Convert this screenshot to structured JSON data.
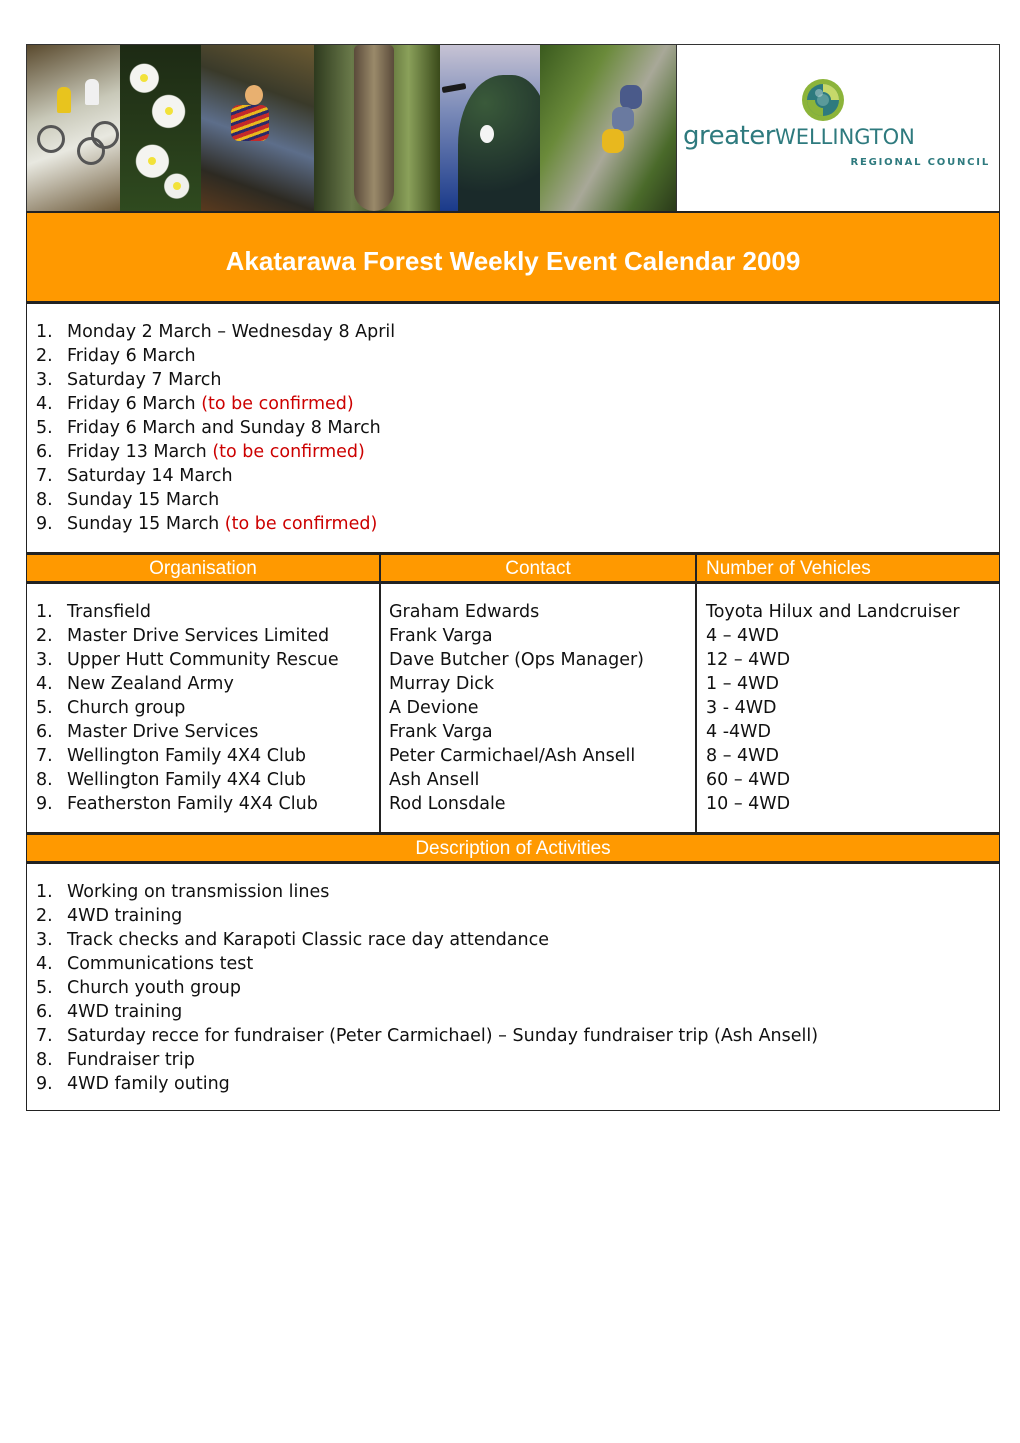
{
  "header": {
    "photos": [
      "cyclists-on-bridge",
      "white-flowers",
      "child-by-stream",
      "forest-tree-trunk",
      "tui-bird",
      "swing-bridge-hikers"
    ],
    "logo": {
      "word_greater": "greater",
      "word_wellington": "WELLINGTON",
      "subtitle": "REGIONAL COUNCIL",
      "colors": {
        "teal": "#2e7a7e",
        "lime": "#8cb43a",
        "light_green": "#c6d86a"
      }
    }
  },
  "title": "Akatarawa Forest Weekly Event Calendar 2009",
  "colors": {
    "accent": "#ff9900",
    "tbc": "#cc0000",
    "header_text": "#ffffff"
  },
  "dates": [
    {
      "num": "1.",
      "text": "Monday 2 March – Wednesday 8 April",
      "note": ""
    },
    {
      "num": "2.",
      "text": "Friday 6 March",
      "note": ""
    },
    {
      "num": "3.",
      "text": "Saturday 7 March",
      "note": ""
    },
    {
      "num": "4.",
      "text": "Friday 6 March ",
      "note": "(to be confirmed)"
    },
    {
      "num": "5.",
      "text": "Friday 6 March and Sunday 8 March",
      "note": ""
    },
    {
      "num": "6.",
      "text": "Friday 13 March ",
      "note": "(to be confirmed)"
    },
    {
      "num": "7.",
      "text": "Saturday 14 March",
      "note": ""
    },
    {
      "num": "8.",
      "text": "Sunday 15 March",
      "note": ""
    },
    {
      "num": "9.",
      "text": "Sunday 15 March ",
      "note": "(to be confirmed)"
    }
  ],
  "table": {
    "headers": {
      "organisation": "Organisation",
      "contact": "Contact",
      "vehicles": "Number of Vehicles"
    },
    "rows": [
      {
        "num": "1.",
        "organisation": "Transfield",
        "contact": "Graham Edwards",
        "vehicles": "Toyota Hilux and Landcruiser"
      },
      {
        "num": "2.",
        "organisation": "Master Drive Services Limited",
        "contact": "Frank Varga",
        "vehicles": "4 – 4WD"
      },
      {
        "num": "3.",
        "organisation": "Upper Hutt Community Rescue",
        "contact": "Dave Butcher (Ops Manager)",
        "vehicles": "12 – 4WD"
      },
      {
        "num": "4.",
        "organisation": "New Zealand Army",
        "contact": "Murray Dick",
        "vehicles": "1 – 4WD"
      },
      {
        "num": "5.",
        "organisation": "Church group",
        "contact": "A Devione",
        "vehicles": "3 - 4WD"
      },
      {
        "num": "6.",
        "organisation": "Master Drive Services",
        "contact": "Frank Varga",
        "vehicles": "4 -4WD"
      },
      {
        "num": "7.",
        "organisation": "Wellington Family 4X4 Club",
        "contact": "Peter Carmichael/Ash Ansell",
        "vehicles": "8 – 4WD"
      },
      {
        "num": "8.",
        "organisation": "Wellington Family 4X4 Club",
        "contact": "Ash Ansell",
        "vehicles": "60 – 4WD"
      },
      {
        "num": "9.",
        "organisation": "Featherston Family 4X4 Club",
        "contact": "Rod Lonsdale",
        "vehicles": "10 – 4WD"
      }
    ]
  },
  "activities": {
    "header": "Description of Activities",
    "items": [
      {
        "num": "1.",
        "text": "Working on transmission lines"
      },
      {
        "num": "2.",
        "text": "4WD training"
      },
      {
        "num": "3.",
        "text": "Track checks and Karapoti Classic race day attendance"
      },
      {
        "num": "4.",
        "text": "Communications test"
      },
      {
        "num": "5.",
        "text": "Church youth group"
      },
      {
        "num": "6.",
        "text": "4WD training"
      },
      {
        "num": "7.",
        "text": "Saturday recce for fundraiser (Peter Carmichael) – Sunday fundraiser trip (Ash Ansell)"
      },
      {
        "num": "8.",
        "text": "Fundraiser trip"
      },
      {
        "num": "9.",
        "text": "4WD family outing"
      }
    ]
  }
}
